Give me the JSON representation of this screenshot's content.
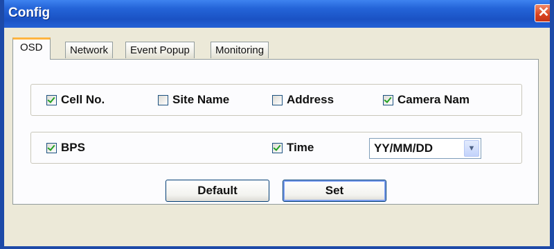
{
  "window": {
    "title": "Config",
    "close_glyph": "✕"
  },
  "tabs": [
    {
      "label": "OSD",
      "active": true
    },
    {
      "label": "Network",
      "active": false
    },
    {
      "label": "Event Popup",
      "active": false
    },
    {
      "label": "Monitoring",
      "active": false
    }
  ],
  "osd": {
    "row1": [
      {
        "label": "Cell No.",
        "checked": true
      },
      {
        "label": "Site Name",
        "checked": false
      },
      {
        "label": "Address",
        "checked": false
      },
      {
        "label": "Camera Nam",
        "checked": true
      }
    ],
    "row2": [
      {
        "label": "BPS",
        "checked": true
      },
      {
        "label": "Time",
        "checked": true
      }
    ],
    "date_format": {
      "selected": "YY/MM/DD"
    }
  },
  "buttons": {
    "default_label": "Default",
    "set_label": "Set"
  },
  "colors": {
    "title_bar": "#2464d8",
    "close_button": "#d9411e",
    "active_tab_accent": "#ffb43e",
    "check_mark": "#21a121"
  }
}
